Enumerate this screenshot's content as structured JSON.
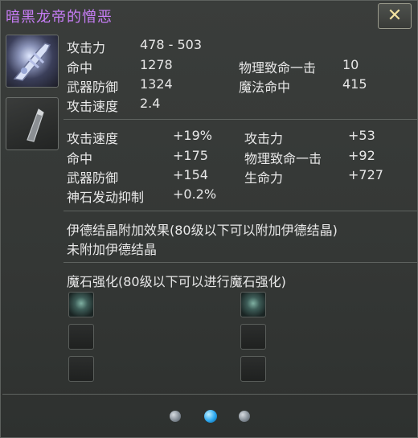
{
  "title": "暗黑龙帝的憎恶",
  "close_label": "✕",
  "base_stats": [
    {
      "label": "攻击力",
      "value": "478 - 503"
    },
    {
      "label": "命中",
      "value": "1278"
    },
    {
      "label": "物理致命一击",
      "value": "10"
    },
    {
      "label": "武器防御",
      "value": "1324"
    },
    {
      "label": "魔法命中",
      "value": "415"
    },
    {
      "label": "攻击速度",
      "value": "2.4"
    }
  ],
  "bonus_stats": [
    {
      "label": "攻击速度",
      "value": "+19%"
    },
    {
      "label": "攻击力",
      "value": "+53"
    },
    {
      "label": "命中",
      "value": "+175"
    },
    {
      "label": "物理致命一击",
      "value": "+92"
    },
    {
      "label": "武器防御",
      "value": "+154"
    },
    {
      "label": "生命力",
      "value": "+727"
    },
    {
      "label": "神石发动抑制",
      "value": "+0.2%"
    }
  ],
  "crystal": {
    "heading": "伊德结晶附加效果(80级以下可以附加伊德结晶)",
    "status": "未附加伊德结晶"
  },
  "manastone": {
    "heading": "魔石强化(80级以下可以进行魔石强化)"
  },
  "icons": {
    "weapon": "sword-icon",
    "gem": "godstone-icon",
    "close": "close-icon"
  },
  "colors": {
    "title": "#c77df5",
    "active_page": "#2aa7f0"
  },
  "pager": {
    "count": 3,
    "active": 2
  }
}
